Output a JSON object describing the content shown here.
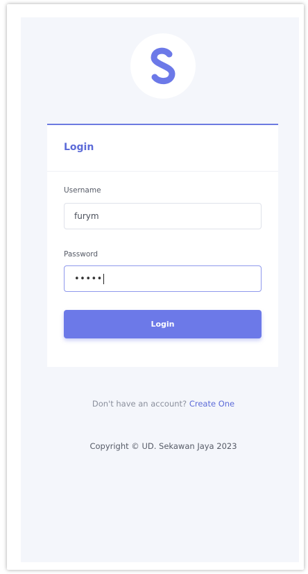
{
  "logo": {
    "letter_icon": "s-logo-icon",
    "color": "#6c79e8"
  },
  "card": {
    "title": "Login",
    "accent_color": "#6c7ae0"
  },
  "form": {
    "username_label": "Username",
    "username_value": "furym",
    "password_label": "Password",
    "password_value": "•••••",
    "submit_label": "Login"
  },
  "footer": {
    "signup_prompt": "Don't have an account?",
    "signup_link": "Create One",
    "copyright": "Copyright © UD. Sekawan Jaya 2023"
  }
}
